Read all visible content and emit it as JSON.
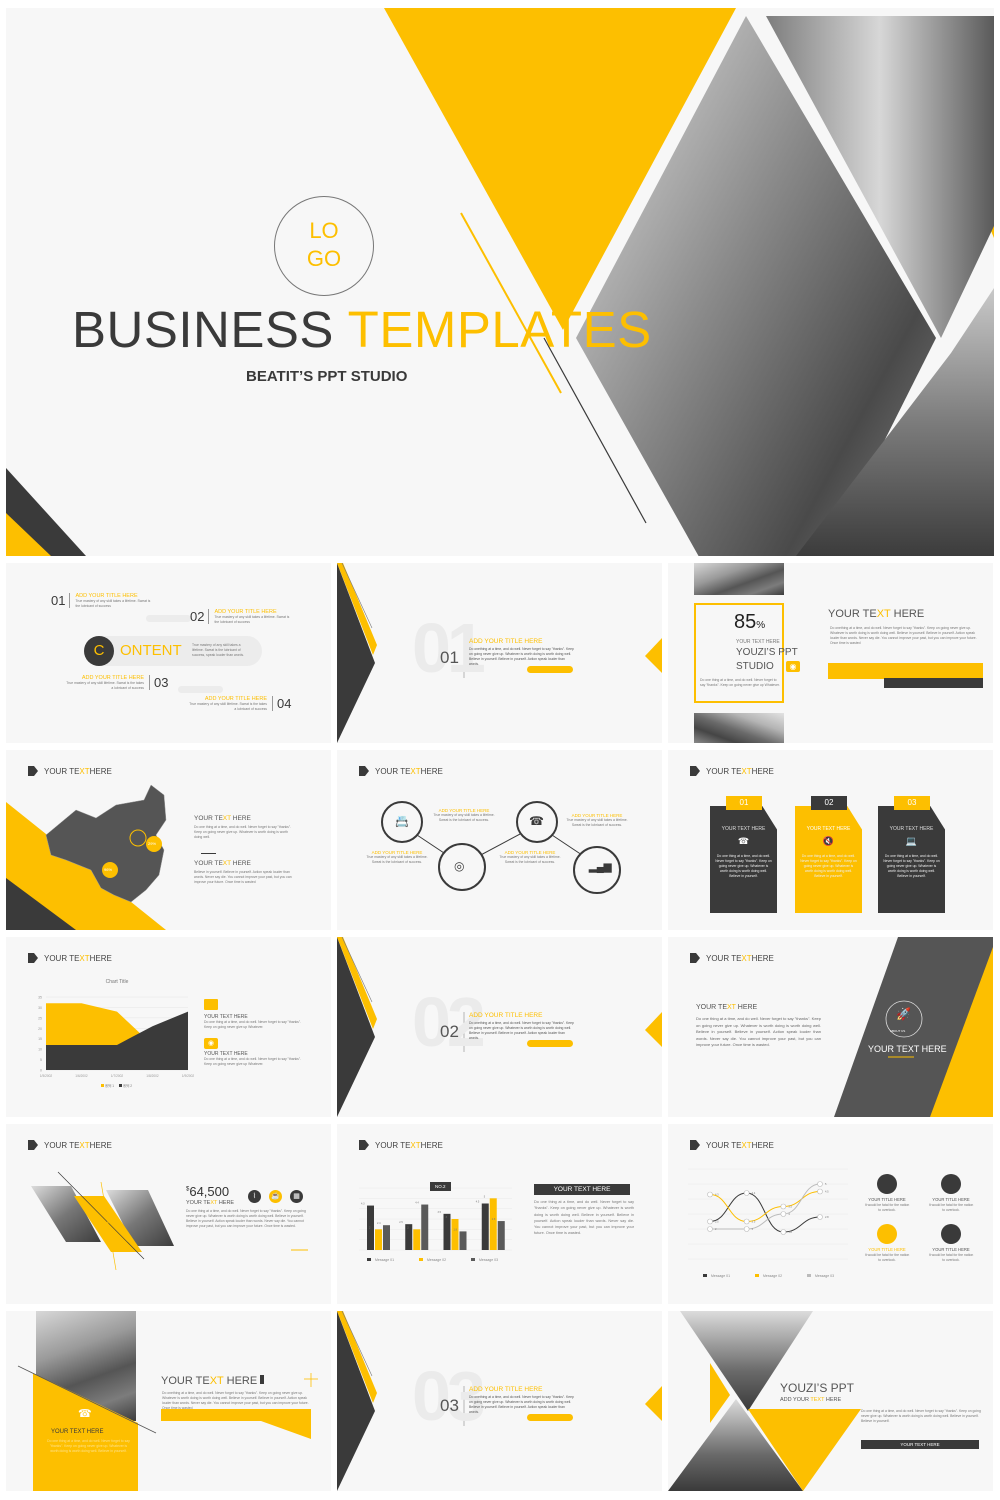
{
  "colors": {
    "accent": "#fdbf00",
    "dark": "#3a3a3a",
    "background": "#f7f7f7"
  },
  "cover": {
    "logo_line1": "LO",
    "logo_line2": "GO",
    "title_dark": "BUSINESS",
    "title_accent": "TEMPLATES",
    "subtitle": "BEATIT’S PPT STUDIO"
  },
  "contents": {
    "badge_letter": "C",
    "badge_rest": "ONTENT",
    "badge_desc": "True mastery of any skill takes a lifetime. Sweat is the lubricant of success, speak louder than words.",
    "items": [
      {
        "num": "01",
        "title": "ADD YOUR TITLE HERE",
        "desc": "True mastery of any skill takes a lifetime. Sweat is the lubricant of success"
      },
      {
        "num": "02",
        "title": "ADD YOUR TITLE HERE",
        "desc": "True mastery of any skill takes a lifetime. Sweat is the lubricant of success"
      },
      {
        "num": "03",
        "title": "ADD YOUR TITLE HERE",
        "desc": "True mastery of any skill lifetime. Sweat is the takes a lubricant of success"
      },
      {
        "num": "04",
        "title": "ADD YOUR TITLE HERE",
        "desc": "True mastery of any skill lifetime. Sweat is the takes a lubricant of success"
      }
    ]
  },
  "section_slides": [
    {
      "num": "01",
      "big": "01",
      "title": "ADD YOUR TITLE HERE",
      "desc": "Do onething at a time, and do well. Never forget to say \"thanks\". Keep on going never give up. Whatever is worth doing is worth doing well. Believe in yourself. Believe in yourself. Action speak louder than words."
    },
    {
      "num": "02",
      "big": "02",
      "title": "ADD YOUR TITLE HERE",
      "desc": "Do onething at a time, and do well. Never forget to say \"thanks\". Keep on going never give up. Whatever is worth doing is worth doing well. Believe in yourself. Believe in yourself. Action speak louder than words."
    },
    {
      "num": "03",
      "big": "03",
      "title": "ADD YOUR TITLE HERE",
      "desc": "Do onething at a time, and do well. Never forget to say \"thanks\". Keep on going never give up. Whatever is worth doing is worth doing well. Believe in yourself. Believe in yourself. Action speak louder than words."
    }
  ],
  "header": {
    "pre": "YOUR TE",
    "accent": "XT",
    "post": " HERE"
  },
  "stat_slide": {
    "percent": "85",
    "percent_sign": "%",
    "sub": "YOUR TEXT HERE",
    "studio1": "YOUZI’S PPT",
    "studio2": "STUDIO",
    "desc": "Do one thing at a time, and do well. Never forget to say \"thanks\". Keep on going never give up Whatever.",
    "desc_right": "Do onething at a time, and do well. Never forget to say \"thanks\". Keep on going never give up. Whatever is worth doing is worth doing well. Believe in yourself. Believe in yourself. Action speak louder than words. Never say die. You cannot improve your past, but you can improve your future. Once time is wasted"
  },
  "map_slide": {
    "pct_a": "29%",
    "pct_b": "96%",
    "desc1": "Do one thing at a time, and do well. Never forget to say \"thanks\". Keep on going never give up. Whatever is worth doing is worth doing well.",
    "desc2": "Believe in yourself. Believe in yourself. Action speak louder than words. Never say die. You cannot improve your past, but you can improve your future. Once time is wasted"
  },
  "process_slide": {
    "items": [
      {
        "title": "ADD YOUR TITLE HERE",
        "desc": "True mastery of any skill takes a lifetime. Sweat is the lubricant of success.",
        "icon": "contacts-icon"
      },
      {
        "title": "ADD YOUR TITLE HERE",
        "desc": "True mastery of any skill takes a lifetime. Sweat is the lubricant of success.",
        "icon": "target-icon"
      },
      {
        "title": "ADD YOUR TITLE HERE",
        "desc": "True mastery of any skill takes a lifetime. Sweat is the lubricant of success.",
        "icon": "telephone-icon"
      },
      {
        "title": "ADD YOUR TITLE HERE",
        "desc": "True mastery of any skill takes a lifetime. Sweat is the lubricant of success.",
        "icon": "signal-bars-icon"
      }
    ]
  },
  "cards_slide": {
    "cards": [
      {
        "num": "01",
        "title": "YOUR TEXT HERE",
        "icon": "☎",
        "desc": "Do one thing at a time, and do well. Never forget to say \"thanks\". Keep on going never give up. Whatever is worth doing is worth doing well. Believe in yourself."
      },
      {
        "num": "02",
        "title": "YOUR TEXT HERE",
        "icon": "🔇",
        "desc": "Do one thing at a time, and do well. Never forget to say \"thanks\". Keep on going never give up. Whatever is worth doing is worth doing well. Believe in yourself."
      },
      {
        "num": "03",
        "title": "YOUR TEXT HERE",
        "icon": "💻",
        "desc": "Do one thing at a time, and do well. Never forget to say \"thanks\". Keep on going never give up. Whatever is worth doing is worth doing well. Believe in yourself."
      }
    ]
  },
  "area_slide": {
    "item1_title": "YOUR TEXT HERE",
    "item1_desc": "Do one thing at a time, and do well. Never forget to say \"thanks\". Keep on going never give up Whatever.",
    "item2_title": "YOUR TEXT HERE",
    "item2_desc": "Do one thing at a time, and do well. Never forget to say \"thanks\". Keep on going never give up Whatever."
  },
  "about_slide": {
    "title": "YOUR TEXT HERE",
    "badge": "ABOUT US",
    "panel_title": "YOUR TEXT HERE",
    "desc": "Do one thing at a time, and do well. Never forget to say \"thanks\". Keep on going never give up. Whatever is worth doing is worth doing well. Believe in yourself. Believe in yourself. Action speak louder than words. Never say die. You cannot improve your past, but you can improve your future. Once time is wasted."
  },
  "price_slide": {
    "currency": "$",
    "amount": "64,500",
    "desc": "Do one thing at a time, and do well. Never forget to say \"thanks\". Keep on going never give up. Whatever is worth doing is worth doing well. Believe in yourself. Believe in yourself. Action speak louder than words. Never say die. You cannot improve your past, but you can improve your future. Once time is wasted."
  },
  "bar_slide": {
    "callout": "NO.2",
    "box_title": "YOUR TEXT HERE",
    "desc": "Do one thing at a time, and do well. Never forget to say \"thanks\". Keep on going never give up. Whatever is worth doing is worth doing well. Believe in yourself. Believe in yourself. Action speak louder than words. Never say die. You cannot improve your past, but you can improve your future. Once time is wasted."
  },
  "line_slide": {
    "features": [
      {
        "title": "YOUR TITLE HERE",
        "desc": "It would be fatal for the nation to overlook.",
        "accent": false
      },
      {
        "title": "YOUR TITLE HERE",
        "desc": "It would be fatal for the nation to overlook.",
        "accent": false
      },
      {
        "title": "YOUR TITLE HERE",
        "desc": "It would be fatal for the nation to overlook.",
        "accent": true
      },
      {
        "title": "YOUR TITLE HERE",
        "desc": "It would be fatal for the nation to overlook.",
        "accent": false
      }
    ]
  },
  "photo_slide": {
    "card_title": "YOUR TEXT HERE",
    "card_desc": "Do one thing at a time, and do well. Never forget to say \"thanks\". Keep on going never give up. Whatever is worth doing is worth doing well. Believe in yourself.",
    "desc": "Do onething at a time, and do well. Never forget to say \"thanks\". Keep on going never give up. Whatever is worth doing is worth doing well. Believe in yourself. Believe in yourself. Action speak louder than words. Never say die. You cannot improve your past, but you can improve your future. Once time is wasted"
  },
  "final_slide": {
    "title": "YOUZI’S PPT",
    "sub_pre": "ADD YOUR ",
    "sub_accent": "TEXT",
    "sub_post": " HERE",
    "desc": "Do one thing at a time, and do well. Never forget to say \"thanks\". Keep on going never give up. Whatever is worth doing is worth doing well. Believe in yourself. Believe in yourself.",
    "button": "YOUR TEXT HERE"
  },
  "chart_data": [
    {
      "type": "area",
      "title": "Chart Title",
      "x": [
        "1/5/2002",
        "1/6/2002",
        "1/7/2002",
        "1/8/2002",
        "1/9/2002"
      ],
      "ylim": [
        0,
        35
      ],
      "yticks": [
        0,
        5,
        10,
        15,
        20,
        25,
        30,
        35
      ],
      "series": [
        {
          "name": "系列 1",
          "values": [
            32,
            32,
            28,
            12,
            7
          ],
          "color": "#fdbf00"
        },
        {
          "name": "系列 2",
          "values": [
            12,
            12,
            12,
            21,
            28
          ],
          "color": "#3a3a3a"
        }
      ],
      "legend": "bottom",
      "grid": true
    },
    {
      "type": "bar",
      "categories": [
        "1",
        "2",
        "3",
        "4"
      ],
      "series": [
        {
          "name": "Message 01",
          "values": [
            4.3,
            2.5,
            3.5,
            4.5
          ],
          "color": "#3a3a3a"
        },
        {
          "name": "Message 02",
          "values": [
            2.0,
            2.0,
            3.0,
            5.0
          ],
          "color": "#fdbf00"
        },
        {
          "name": "Message 03",
          "values": [
            2.4,
            4.4,
            1.8,
            2.8
          ],
          "color": "#5a5a5a"
        }
      ],
      "ylim": [
        0,
        6
      ],
      "legend": "bottom",
      "grid": true
    },
    {
      "type": "line",
      "categories": [
        "1",
        "2",
        "3",
        "4",
        "5"
      ],
      "series": [
        {
          "name": "Message 01",
          "values": [
            2.5,
            4.4,
            1.8,
            2.8
          ],
          "color": "#3a3a3a"
        },
        {
          "name": "Message 02",
          "values": [
            4.3,
            2.5,
            3.5,
            4.5
          ],
          "color": "#fdbf00"
        },
        {
          "name": "Message 03",
          "values": [
            2.0,
            2.0,
            3.0,
            5.0
          ],
          "color": "#bbbbbb"
        }
      ],
      "ylim": [
        0,
        6
      ],
      "legend": "bottom",
      "grid": true
    }
  ]
}
